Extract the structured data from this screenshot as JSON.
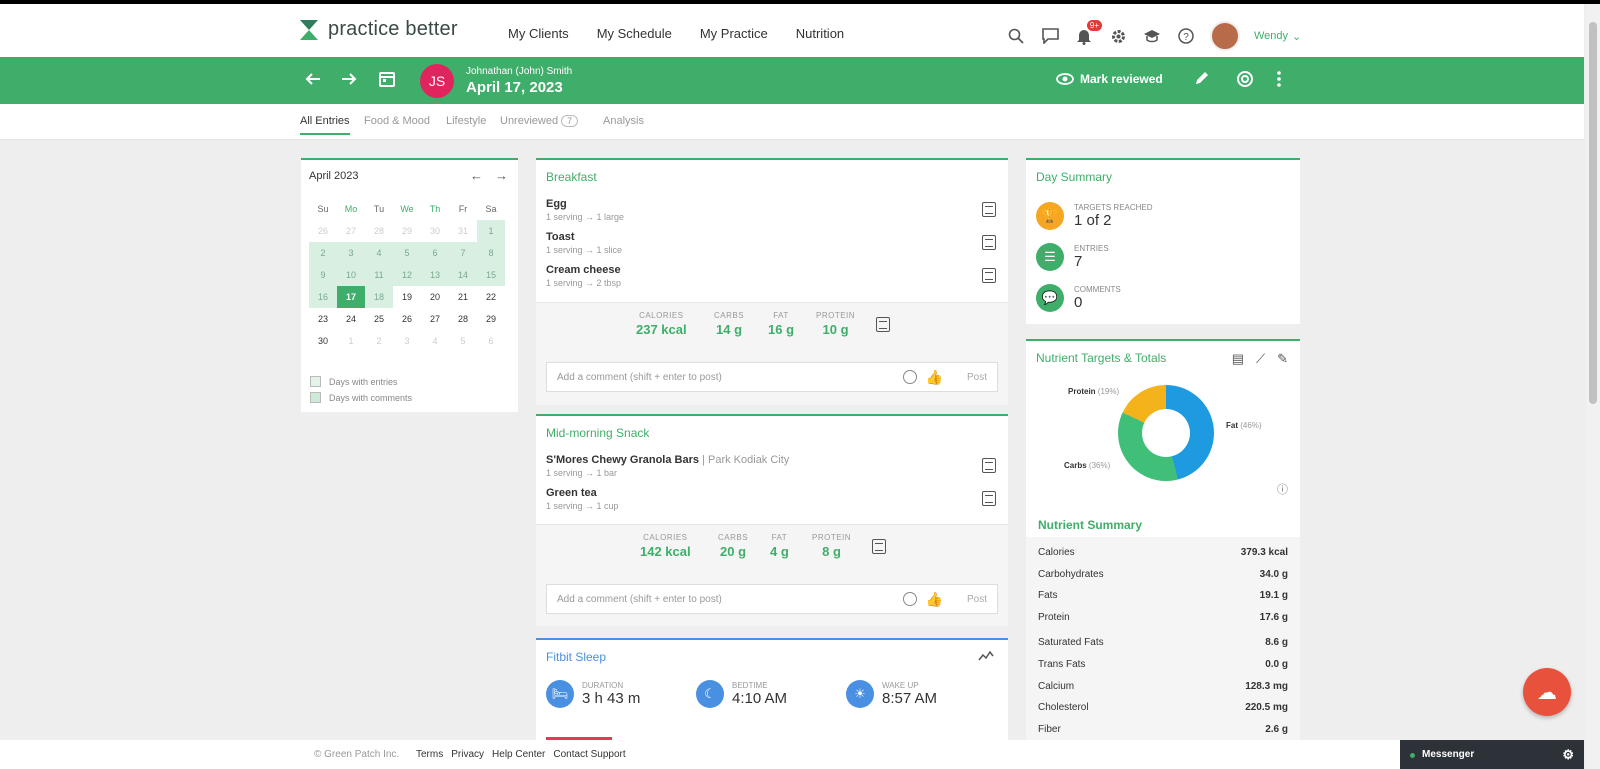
{
  "app": {
    "logo": "practice better",
    "nav": [
      "My Clients",
      "My Schedule",
      "My Practice",
      "Nutrition"
    ],
    "notification_count": "9+",
    "user_name": "Wendy"
  },
  "client": {
    "initials": "JS",
    "name": "Johnathan (John) Smith",
    "date": "April 17, 2023",
    "mark_reviewed": "Mark reviewed"
  },
  "tabs": {
    "all": "All Entries",
    "food": "Food & Mood",
    "lifestyle": "Lifestyle",
    "unreviewed": "Unreviewed",
    "unreviewed_count": "7",
    "analysis": "Analysis"
  },
  "calendar": {
    "month": "April 2023",
    "days": [
      "Su",
      "Mo",
      "Tu",
      "We",
      "Th",
      "Fr",
      "Sa"
    ],
    "cells": [
      [
        "26",
        "27",
        "28",
        "29",
        "30",
        "31",
        "1"
      ],
      [
        "2",
        "3",
        "4",
        "5",
        "6",
        "7",
        "8"
      ],
      [
        "9",
        "10",
        "11",
        "12",
        "13",
        "14",
        "15"
      ],
      [
        "16",
        "17",
        "18",
        "19",
        "20",
        "21",
        "22"
      ],
      [
        "23",
        "24",
        "25",
        "26",
        "27",
        "28",
        "29"
      ],
      [
        "30",
        "1",
        "2",
        "3",
        "4",
        "5",
        "6"
      ]
    ],
    "legend_entries": "Days with entries",
    "legend_comments": "Days with comments"
  },
  "breakfast": {
    "title": "Breakfast",
    "items": [
      {
        "name": "Egg",
        "qty": "1 serving → 1 large"
      },
      {
        "name": "Toast",
        "qty": "1 serving → 1 slice"
      },
      {
        "name": "Cream cheese",
        "qty": "1 serving → 2 tbsp"
      }
    ],
    "totals": {
      "calories_label": "CALORIES",
      "calories": "237 kcal",
      "carbs_label": "CARBS",
      "carbs": "14 g",
      "fat_label": "FAT",
      "fat": "16 g",
      "protein_label": "PROTEIN",
      "protein": "10 g"
    },
    "comment_placeholder": "Add a comment (shift + enter to post)",
    "post": "Post"
  },
  "snack": {
    "title": "Mid-morning Snack",
    "items": [
      {
        "name": "S'Mores Chewy Granola Bars",
        "brand": "Park Kodiak City",
        "qty": "1 serving → 1 bar"
      },
      {
        "name": "Green tea",
        "qty": "1 serving → 1 cup"
      }
    ],
    "totals": {
      "calories_label": "CALORIES",
      "calories": "142 kcal",
      "carbs_label": "CARBS",
      "carbs": "20 g",
      "fat_label": "FAT",
      "fat": "4 g",
      "protein_label": "PROTEIN",
      "protein": "8 g"
    },
    "comment_placeholder": "Add a comment (shift + enter to post)",
    "post": "Post"
  },
  "sleep": {
    "title": "Fitbit Sleep",
    "duration_label": "DURATION",
    "duration": "3 h 43 m",
    "bedtime_label": "BEDTIME",
    "bedtime": "4:10 AM",
    "wakeup_label": "WAKE UP",
    "wakeup": "8:57 AM"
  },
  "day_summary": {
    "title": "Day Summary",
    "targets_label": "TARGETS REACHED",
    "targets": "1 of 2",
    "entries_label": "ENTRIES",
    "entries": "7",
    "comments_label": "COMMENTS",
    "comments": "0"
  },
  "nutrients": {
    "title": "Nutrient Targets & Totals",
    "donut": [
      {
        "name": "Protein",
        "pct": "(19%)",
        "value": 19,
        "color": "#f5b31b"
      },
      {
        "name": "Fat",
        "pct": "(46%)",
        "value": 46,
        "color": "#1e9be0"
      },
      {
        "name": "Carbs",
        "pct": "(36%)",
        "value": 36,
        "color": "#3fbf78"
      }
    ],
    "summary_title": "Nutrient Summary",
    "rows": [
      {
        "name": "Calories",
        "value": "379.3 kcal"
      },
      {
        "name": "Carbohydrates",
        "value": "34.0 g"
      },
      {
        "name": "Fats",
        "value": "19.1 g"
      },
      {
        "name": "Protein",
        "value": "17.6 g"
      },
      {
        "name": "Saturated Fats",
        "value": "8.6 g"
      },
      {
        "name": "Trans Fats",
        "value": "0.0 g"
      },
      {
        "name": "Calcium",
        "value": "128.3 mg"
      },
      {
        "name": "Cholesterol",
        "value": "220.5 mg"
      },
      {
        "name": "Fiber",
        "value": "2.6 g"
      }
    ]
  },
  "footer": {
    "copyright": "© Green Patch Inc.",
    "links": [
      "Terms",
      "Privacy",
      "Help Center",
      "Contact Support"
    ],
    "messenger": "Messenger"
  }
}
